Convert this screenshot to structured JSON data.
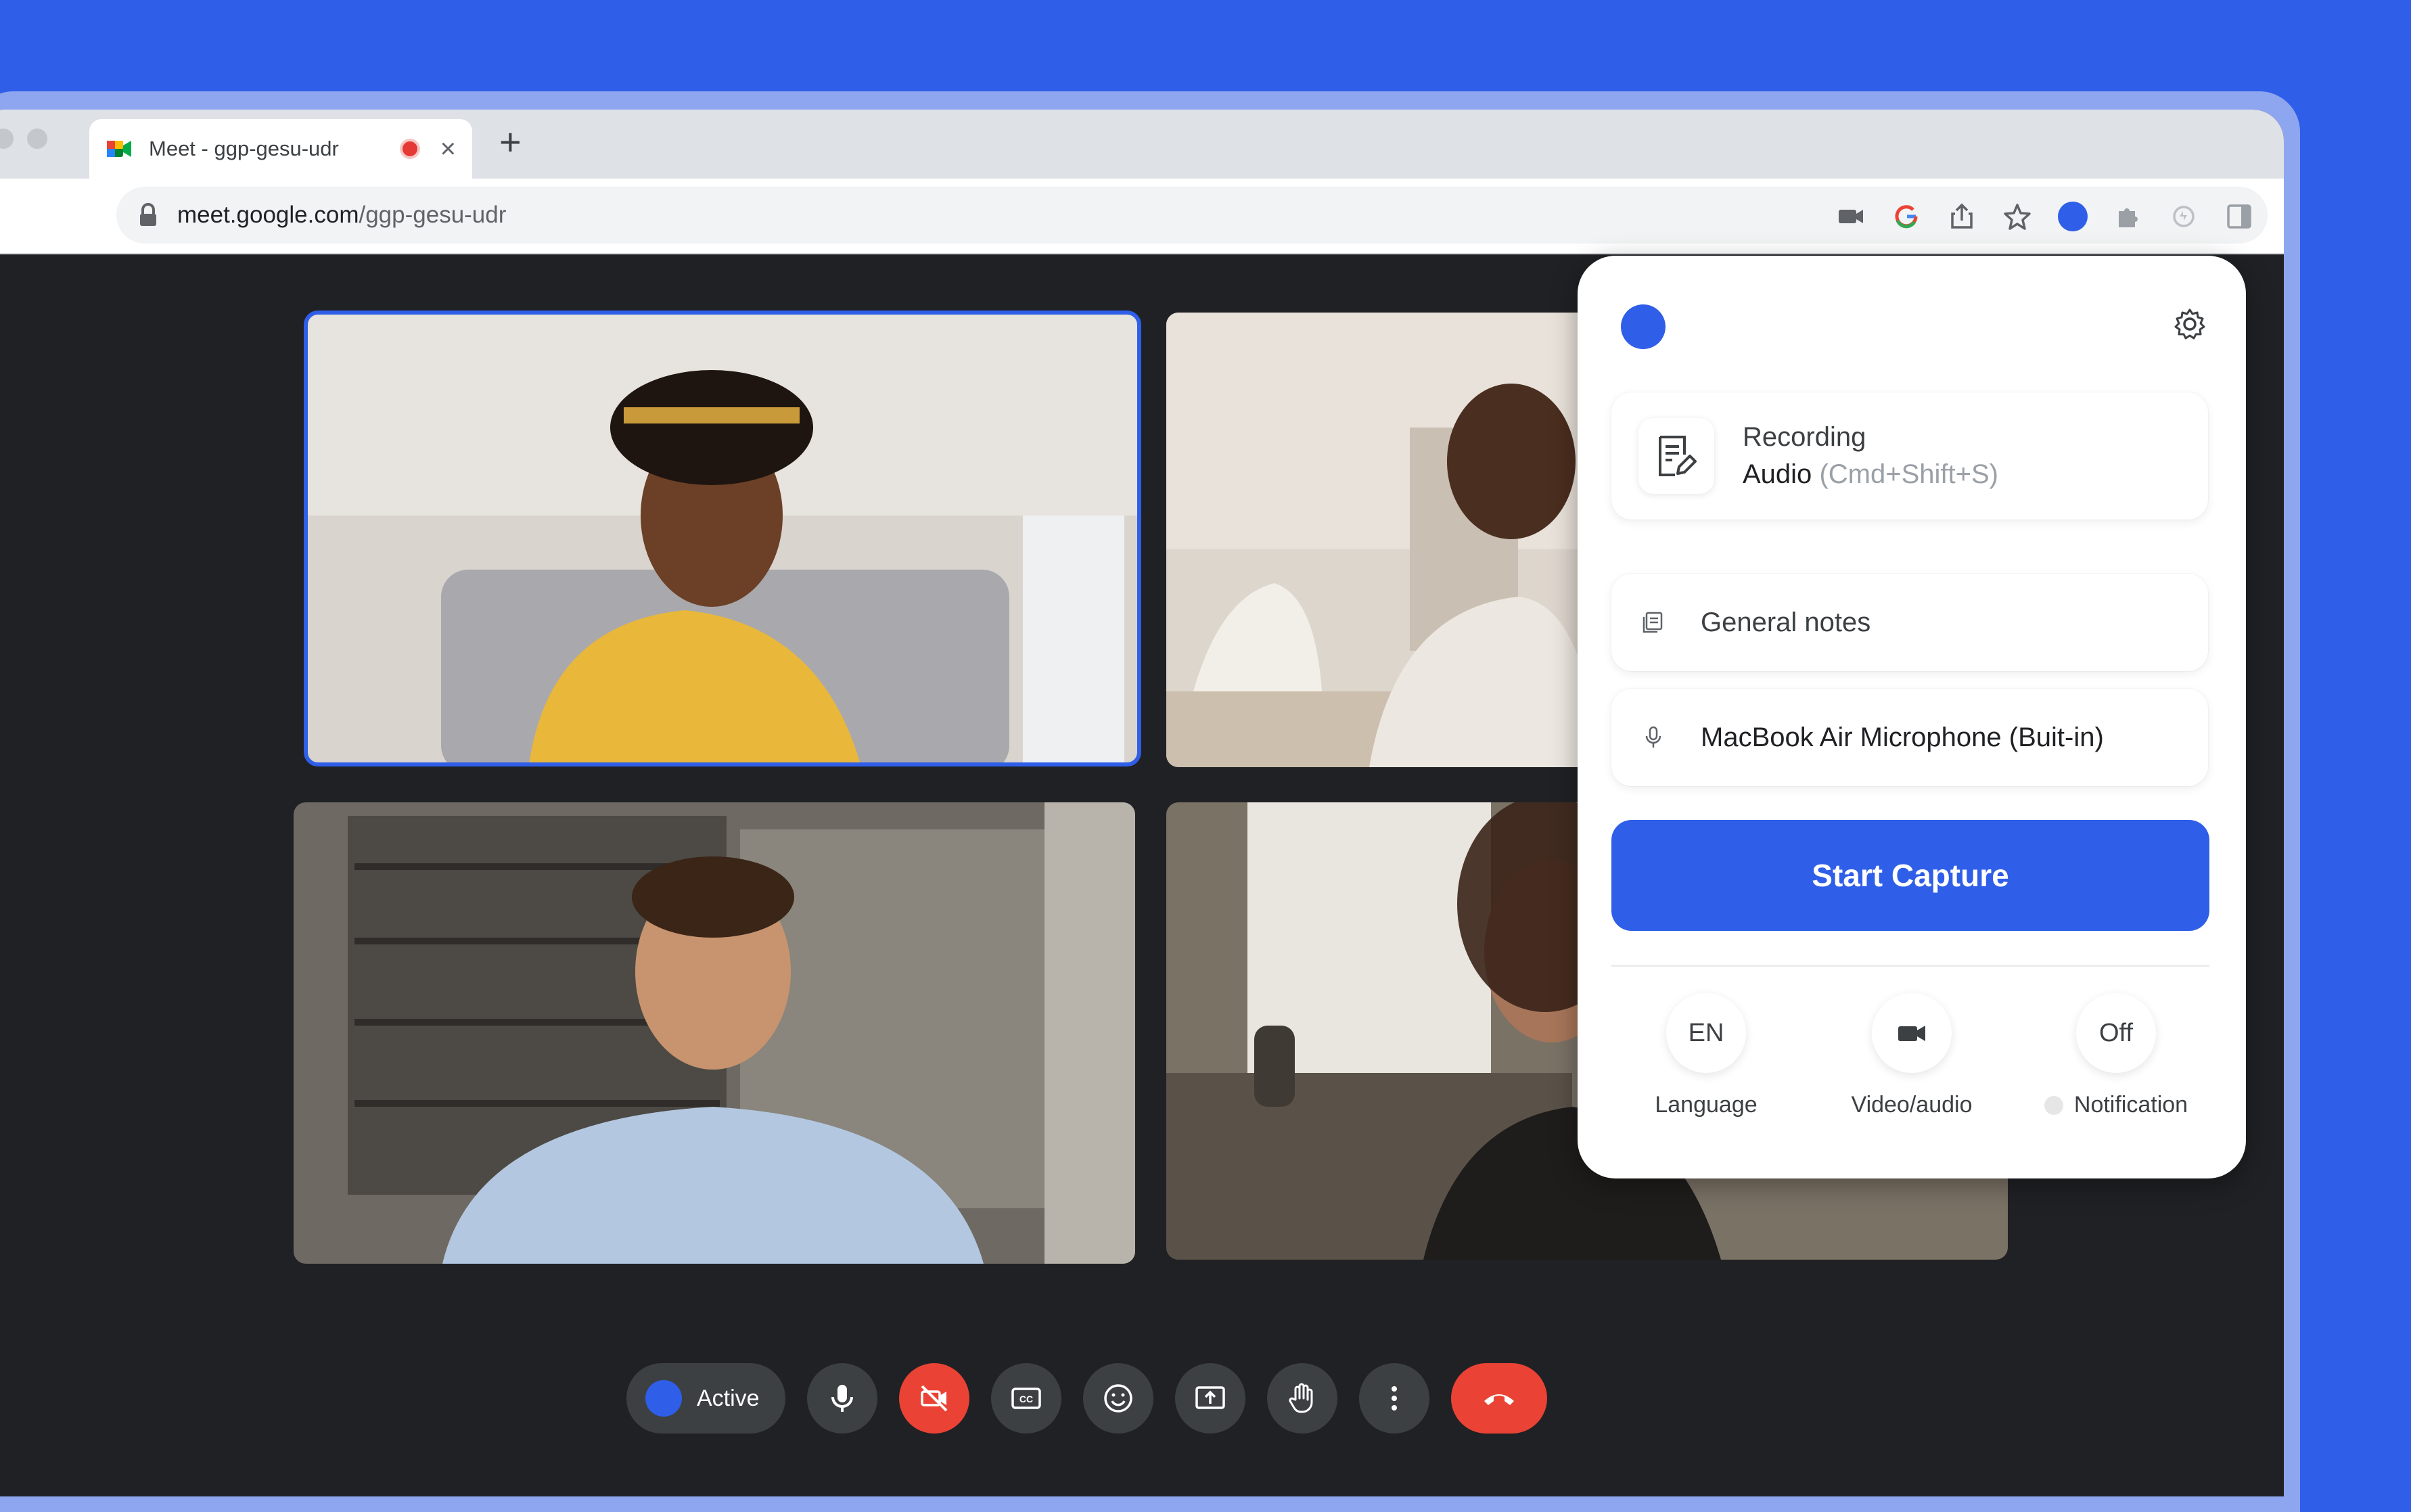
{
  "browser": {
    "tab_title": "Meet - ggp-gesu-udr",
    "url_host": "meet.google.com",
    "url_path": "/ggp-gesu-udr",
    "new_tab_glyph": "+",
    "close_glyph": "×",
    "toolbar_icons": [
      "camera-icon",
      "google-icon",
      "share-icon",
      "star-icon",
      "extension-dot-icon",
      "puzzle-icon",
      "sync-icon",
      "sidepanel-icon"
    ]
  },
  "meeting": {
    "tiles": [
      "participant-1",
      "participant-2",
      "participant-3",
      "participant-4"
    ],
    "controls": {
      "active_label": "Active",
      "buttons": [
        "mic-icon",
        "camera-off-icon",
        "captions-icon",
        "emoji-icon",
        "present-icon",
        "raise-hand-icon",
        "more-icon",
        "hangup-icon"
      ]
    }
  },
  "panel": {
    "recording_title": "Recording",
    "recording_mode": "Audio",
    "recording_shortcut": "(Cmd+Shift+S)",
    "notes_label": "General notes",
    "mic_label": "MacBook Air Microphone (Buit-in)",
    "start_button": "Start Capture",
    "options": [
      {
        "value": "EN",
        "label": "Language"
      },
      {
        "value": "",
        "label": "Video/audio"
      },
      {
        "value": "Off",
        "label": "Notification"
      }
    ]
  },
  "colors": {
    "background": "#2f5ee8",
    "accent": "#2f5ee8",
    "danger": "#ea4335",
    "meet_dark": "#202124"
  }
}
